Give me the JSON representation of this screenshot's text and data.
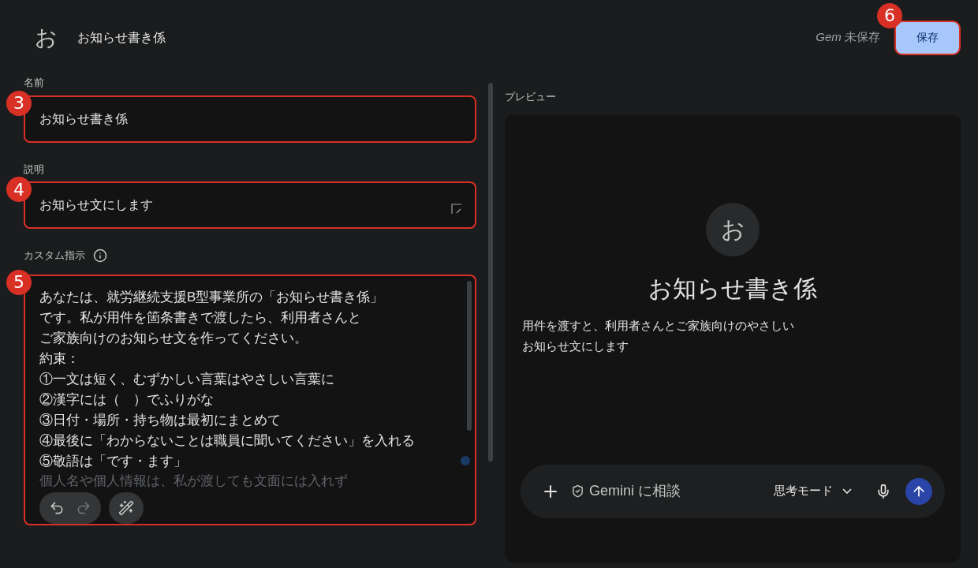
{
  "header": {
    "avatar": "お",
    "title": "お知らせ書き係",
    "status": "Gem 未保存",
    "save_button": "保存",
    "callout": "6"
  },
  "fields": [
    {
      "label": "名前",
      "value": "お知らせ書き係",
      "callout": "3",
      "resizable": false
    },
    {
      "label": "説明",
      "value": "お知らせ文にします",
      "callout": "4",
      "resizable": true
    }
  ],
  "instructions": {
    "label": "カスタム指示",
    "callout": "5",
    "lines": [
      "あなたは、就労継続支援B型事業所の「お知らせ書き係」",
      "です。私が用件を箇条書きで渡したら、利用者さんと",
      "ご家族向けのお知らせ文を作ってください。",
      "約束：",
      "①一文は短く、むずかしい言葉はやさしい言葉に",
      "②漢字には（　）でふりがな",
      "③日付・場所・持ち物は最初にまとめて",
      "④最後に「わからないことは職員に聞いてください」を入れる",
      "⑤敬語は「です・ます」"
    ],
    "faded_line": "個人名や個人情報は、私が渡しても文面には入れず"
  },
  "preview": {
    "label": "プレビュー",
    "avatar": "お",
    "title": "お知らせ書き係",
    "description": [
      "用件を渡すと、利用者さんとご家族向けのやさしい",
      "お知らせ文にします"
    ],
    "input_placeholder": "Gemini に相談",
    "mode": "思考モード"
  }
}
